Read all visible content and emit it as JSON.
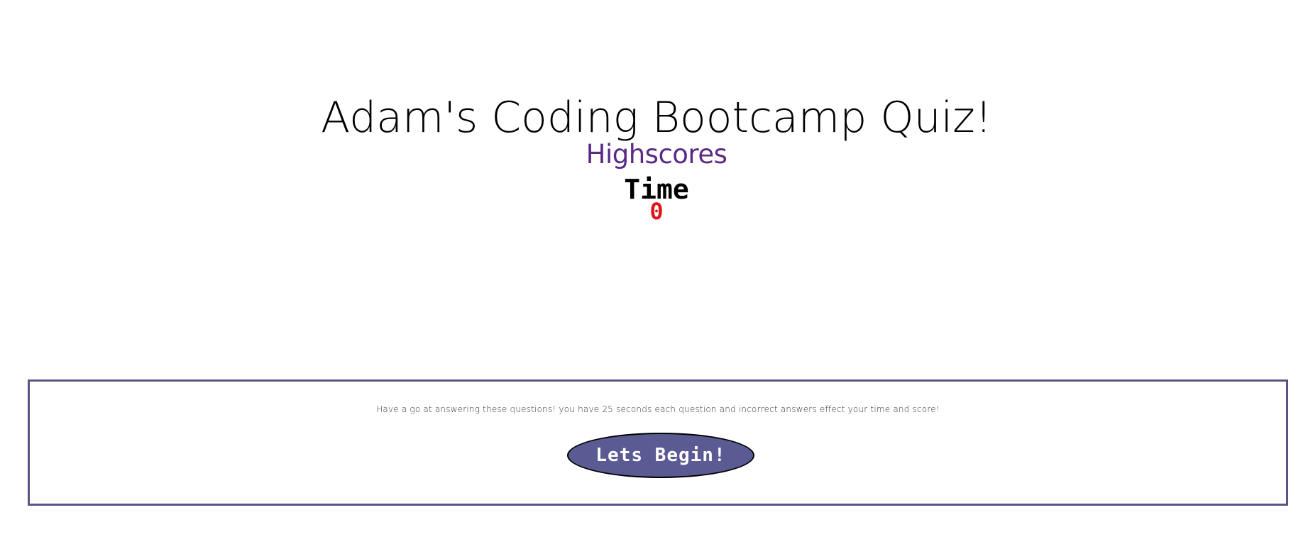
{
  "header": {
    "title": "Adam's Coding Bootcamp Quiz!",
    "highscores_label": "Highscores"
  },
  "timer": {
    "label": "Time",
    "value": "0"
  },
  "intro": {
    "text": "Have a go at answering these questions! you have 25 seconds each question and incorrect answers effect your time and score!",
    "begin_label": "Lets Begin!"
  },
  "colors": {
    "link": "#5b2a86",
    "timer_value": "#e0141b",
    "box_border": "#5a5482",
    "button_bg": "#5a5b93"
  }
}
